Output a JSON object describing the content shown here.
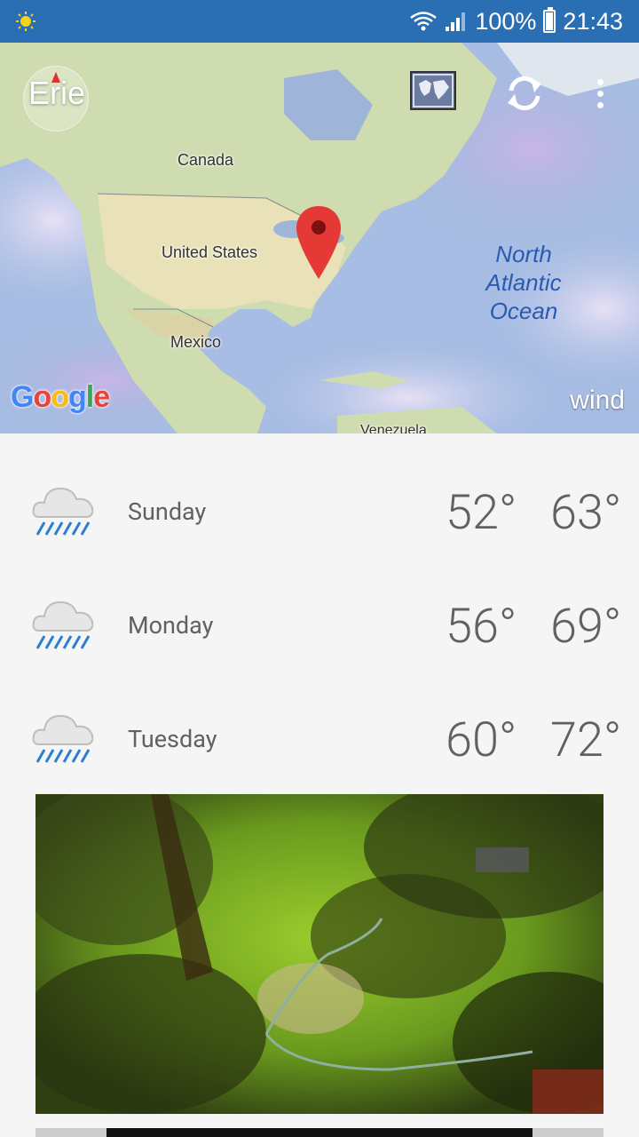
{
  "status_bar": {
    "notification_icon": "weather-sun-icon",
    "battery_percent": "100%",
    "time": "21:43",
    "icons": [
      "wifi-icon",
      "signal-icon",
      "battery-icon"
    ]
  },
  "map": {
    "location_name": "Erie",
    "labels": {
      "canada": "Canada",
      "united_states": "United States",
      "mexico": "Mexico",
      "venezuela": "Venezuela"
    },
    "ocean_label": [
      "North",
      "Atlantic",
      "Ocean"
    ],
    "google_logo": "Google",
    "layer_label": "wind",
    "icons": [
      "compass-icon",
      "map-layers-icon",
      "refresh-icon",
      "overflow-menu-icon",
      "location-pin-icon"
    ]
  },
  "forecast": [
    {
      "day": "Sunday",
      "low": "52°",
      "high": "63°",
      "icon": "rain-cloud-icon"
    },
    {
      "day": "Monday",
      "low": "56°",
      "high": "69°",
      "icon": "rain-cloud-icon"
    },
    {
      "day": "Tuesday",
      "low": "60°",
      "high": "72°",
      "icon": "rain-cloud-icon"
    }
  ],
  "colors": {
    "status_bar": "#2a6fb3",
    "pin": "#e53935",
    "text": "#616161",
    "rain": "#2a7fd0"
  }
}
